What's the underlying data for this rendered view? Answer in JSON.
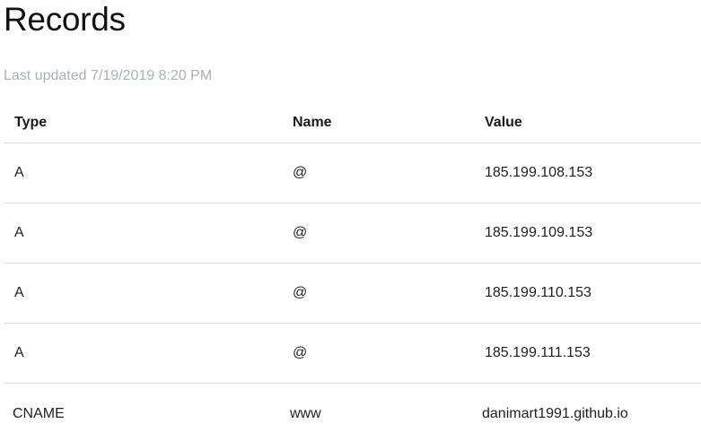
{
  "page": {
    "title": "Records",
    "last_updated": "Last updated 7/19/2019 8:20 PM"
  },
  "table": {
    "headers": {
      "type": "Type",
      "name": "Name",
      "value": "Value"
    },
    "rows": [
      {
        "type": "A",
        "name": "@",
        "value": "185.199.108.153"
      },
      {
        "type": "A",
        "name": "@",
        "value": "185.199.109.153"
      },
      {
        "type": "A",
        "name": "@",
        "value": "185.199.110.153"
      },
      {
        "type": "A",
        "name": "@",
        "value": "185.199.111.153"
      },
      {
        "type": "CNAME",
        "name": "www",
        "value": "danimart1991.github.io"
      }
    ]
  }
}
